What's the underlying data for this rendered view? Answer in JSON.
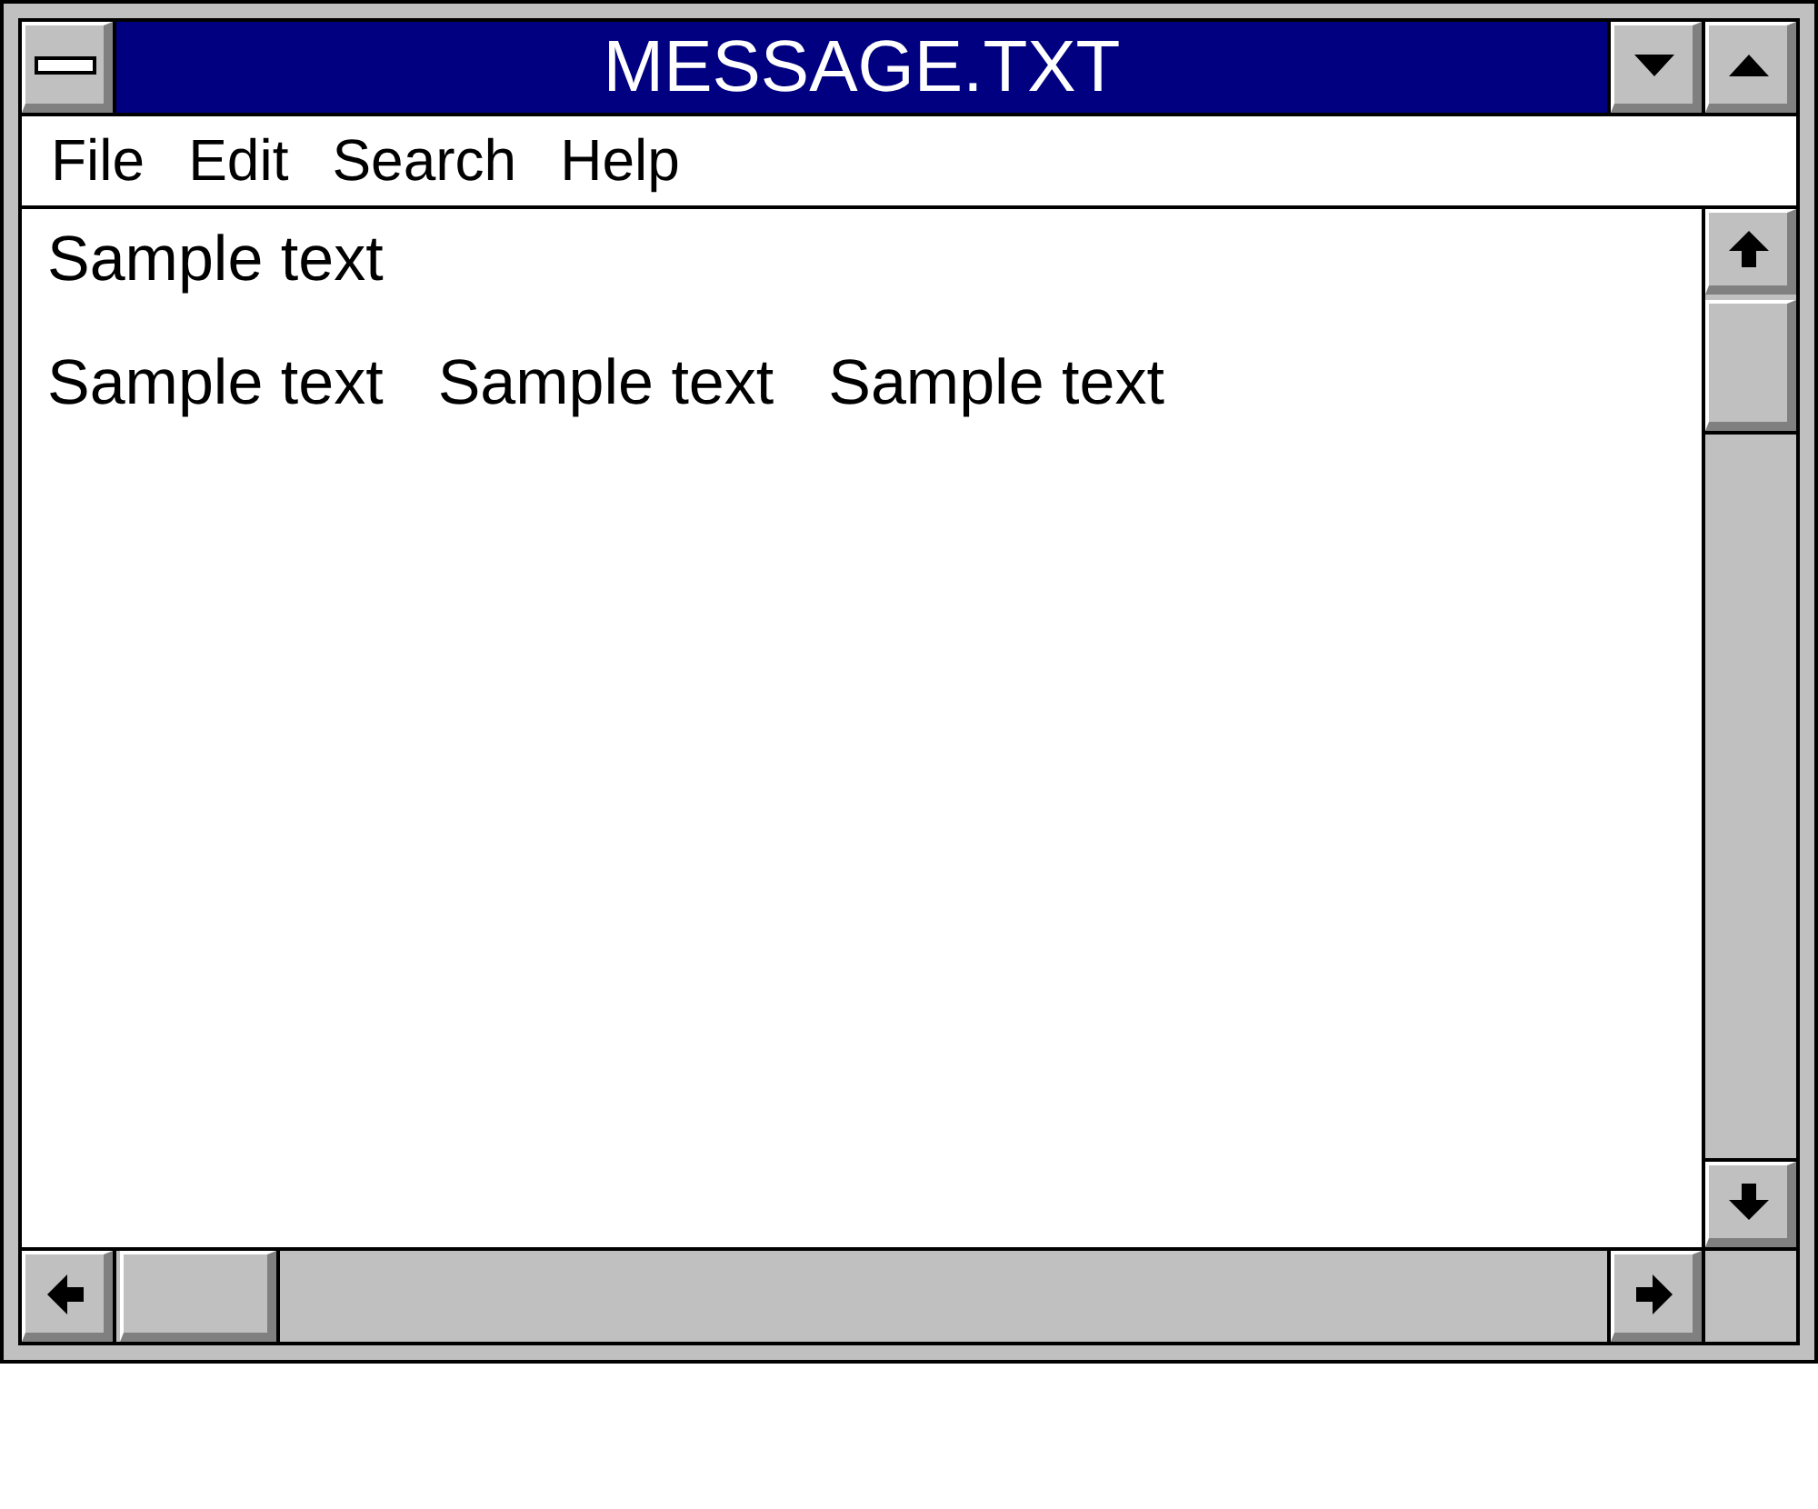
{
  "window": {
    "title": "MESSAGE.TXT"
  },
  "menu": [
    {
      "label": "File"
    },
    {
      "label": "Edit"
    },
    {
      "label": "Search"
    },
    {
      "label": "Help"
    }
  ],
  "document": {
    "lines": [
      {
        "segments": [
          "Sample text"
        ]
      },
      {
        "segments": [
          "Sample text",
          "Sample text",
          "Sample text"
        ]
      }
    ]
  }
}
